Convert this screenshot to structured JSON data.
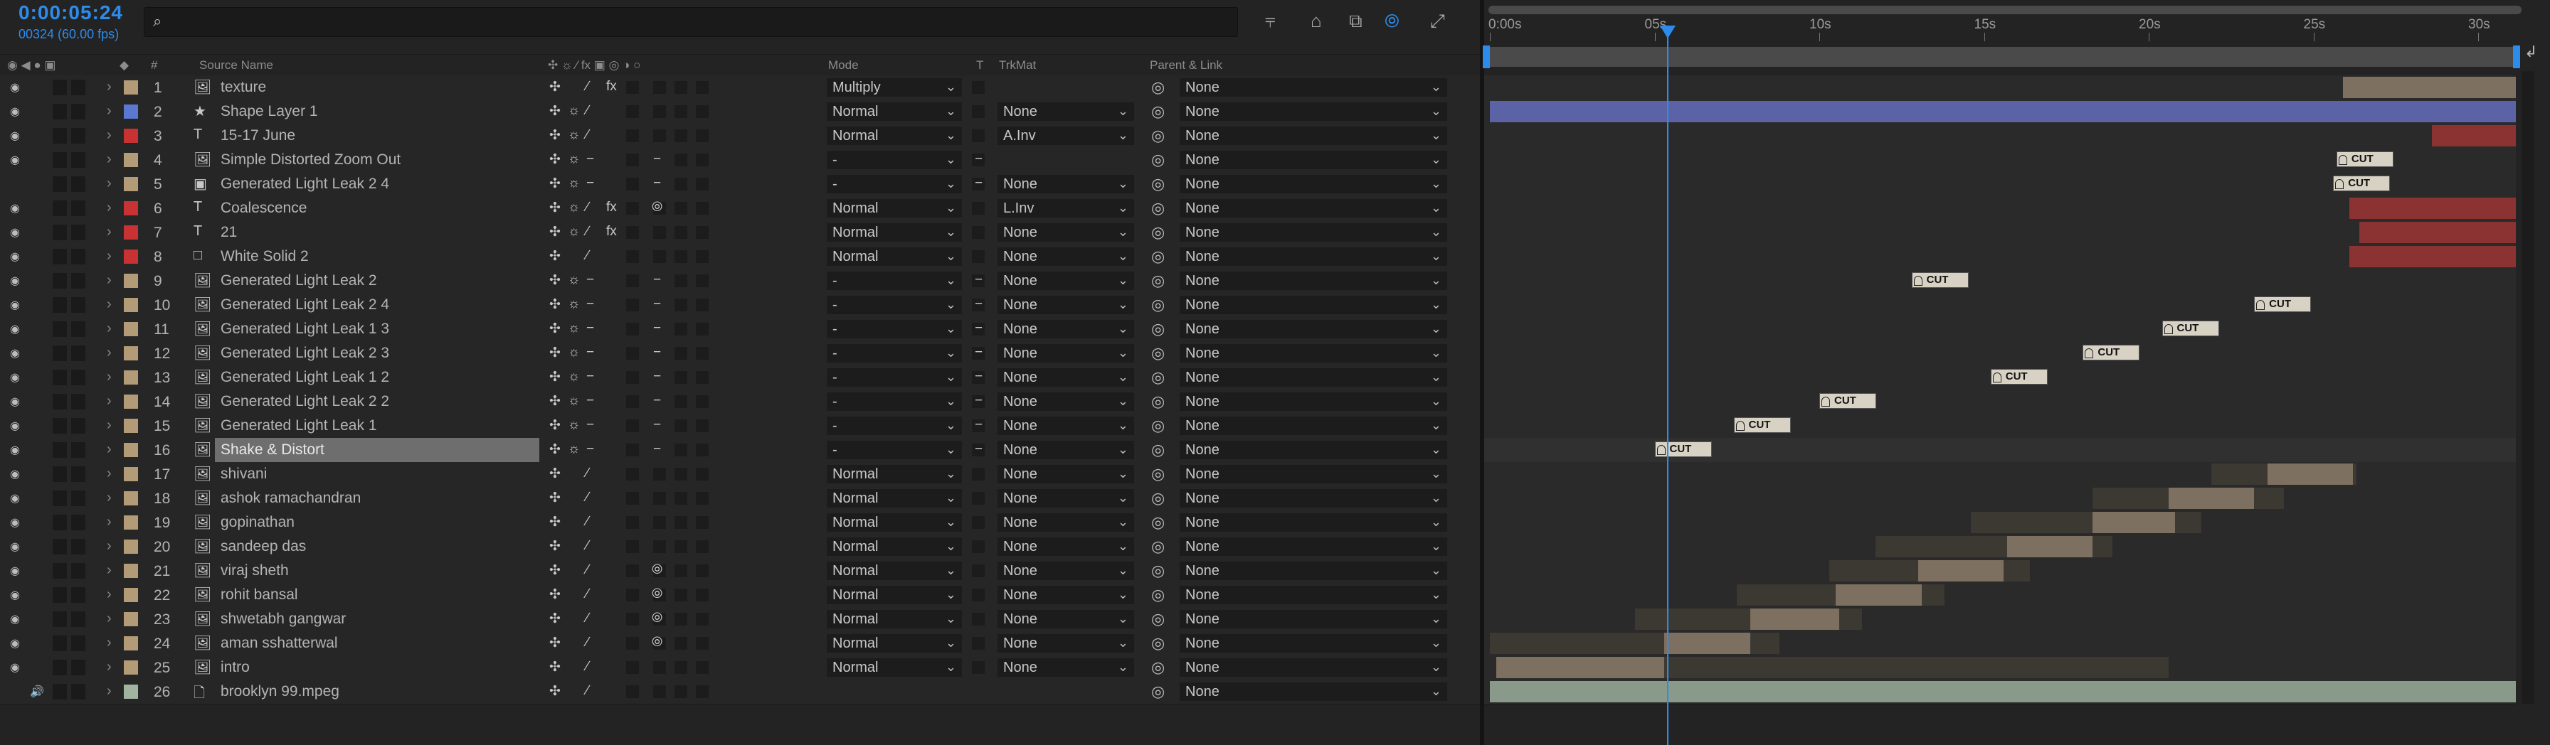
{
  "header": {
    "timecode": "0:00:05:24",
    "frame_info": "00324 (60.00 fps)",
    "search_placeholder": ""
  },
  "columns": {
    "hash": "#",
    "source_name": "Source Name",
    "mode": "Mode",
    "t": "T",
    "trkmat": "TrkMat",
    "parent_link": "Parent & Link"
  },
  "ruler": {
    "labels": [
      "0:00s",
      "05s",
      "10s",
      "15s",
      "20s",
      "25s",
      "30s"
    ],
    "current_time_s": 5.4
  },
  "colors": {
    "accent": "#2d8ceb",
    "label_tan": "#b49b78",
    "label_red": "#c83232",
    "label_blue": "#5a78d2",
    "label_white": "#f0f0f0",
    "label_sage": "#a0b4a0"
  },
  "layers": [
    {
      "num": "1",
      "name": "texture",
      "icon": "footage",
      "label": "#b49b78",
      "mode": "Multiply",
      "trkmat": "",
      "parent": "None",
      "eye": true,
      "switches": [
        "shy",
        "",
        "pencil",
        "fx"
      ],
      "bar": {
        "type": "solid",
        "start": 25.9,
        "end": 31.5,
        "color": "#7e7060"
      }
    },
    {
      "num": "2",
      "name": "Shape Layer 1",
      "icon": "shape",
      "label": "#5a78d2",
      "mode": "Normal",
      "trkmat": "None",
      "parent": "None",
      "eye": true,
      "switches": [
        "shy",
        "sun",
        "pencil",
        ""
      ],
      "bar": {
        "type": "solid",
        "start": 0,
        "end": 31.5,
        "color": "#5b63a6"
      }
    },
    {
      "num": "3",
      "name": "15-17 June",
      "icon": "text",
      "label": "#c83232",
      "mode": "Normal",
      "trkmat": "A.Inv",
      "parent": "None",
      "eye": true,
      "switches": [
        "shy",
        "sun",
        "pencil",
        ""
      ],
      "bar": {
        "type": "solid",
        "start": 28.6,
        "end": 31.5,
        "color": "#8b3232"
      }
    },
    {
      "num": "4",
      "name": "Simple Distorted Zoom Out",
      "icon": "footage",
      "label": "#b49b78",
      "mode": "-",
      "trkmat": "",
      "parent": "None",
      "eye": true,
      "switches": [
        "shy",
        "sun",
        "dash",
        ""
      ],
      "adj": true,
      "bar": {
        "type": "cut",
        "start": 25.7
      }
    },
    {
      "num": "5",
      "name": "Generated Light Leak 2 4",
      "icon": "comp",
      "label": "#b49b78",
      "mode": "-",
      "trkmat": "None",
      "parent": "None",
      "eye": false,
      "switches": [
        "shy",
        "sun",
        "dash",
        ""
      ],
      "adj": true,
      "bar": {
        "type": "cut",
        "start": 25.6
      }
    },
    {
      "num": "6",
      "name": "Coalescence",
      "icon": "text",
      "label": "#c83232",
      "mode": "Normal",
      "trkmat": "L.Inv",
      "parent": "None",
      "eye": true,
      "switches": [
        "shy",
        "sun",
        "pencil",
        "fx"
      ],
      "motion": true,
      "bar": {
        "type": "solid",
        "start": 26.1,
        "end": 31.5,
        "color": "#8b3232"
      }
    },
    {
      "num": "7",
      "name": "21",
      "icon": "text",
      "label": "#c83232",
      "mode": "Normal",
      "trkmat": "None",
      "parent": "None",
      "eye": true,
      "switches": [
        "shy",
        "sun",
        "pencil",
        "fx"
      ],
      "bar": {
        "type": "solid",
        "start": 26.4,
        "end": 31.5,
        "color": "#8b3232"
      }
    },
    {
      "num": "8",
      "name": "White Solid 2",
      "icon": "solid",
      "label": "#c83232",
      "mode": "Normal",
      "trkmat": "None",
      "parent": "None",
      "eye": true,
      "switches": [
        "shy",
        "",
        "pencil",
        ""
      ],
      "bar": {
        "type": "solid",
        "start": 26.1,
        "end": 31.5,
        "color": "#8b3232"
      }
    },
    {
      "num": "9",
      "name": "Generated Light Leak 2",
      "icon": "footage",
      "label": "#b49b78",
      "mode": "-",
      "trkmat": "None",
      "parent": "None",
      "eye": true,
      "switches": [
        "shy",
        "sun",
        "dash",
        ""
      ],
      "adj": true,
      "bar": {
        "type": "cut",
        "start": 12.8
      }
    },
    {
      "num": "10",
      "name": "Generated Light Leak 2 4",
      "icon": "footage",
      "label": "#b49b78",
      "mode": "-",
      "trkmat": "None",
      "parent": "None",
      "eye": true,
      "switches": [
        "shy",
        "sun",
        "dash",
        ""
      ],
      "adj": true,
      "bar": {
        "type": "cut",
        "start": 23.2
      }
    },
    {
      "num": "11",
      "name": "Generated Light Leak 1 3",
      "icon": "footage",
      "label": "#b49b78",
      "mode": "-",
      "trkmat": "None",
      "parent": "None",
      "eye": true,
      "switches": [
        "shy",
        "sun",
        "dash",
        ""
      ],
      "adj": true,
      "bar": {
        "type": "cut",
        "start": 20.4
      }
    },
    {
      "num": "12",
      "name": "Generated Light Leak 2 3",
      "icon": "footage",
      "label": "#b49b78",
      "mode": "-",
      "trkmat": "None",
      "parent": "None",
      "eye": true,
      "switches": [
        "shy",
        "sun",
        "dash",
        ""
      ],
      "adj": true,
      "bar": {
        "type": "cut",
        "start": 18.0
      }
    },
    {
      "num": "13",
      "name": "Generated Light Leak 1 2",
      "icon": "footage",
      "label": "#b49b78",
      "mode": "-",
      "trkmat": "None",
      "parent": "None",
      "eye": true,
      "switches": [
        "shy",
        "sun",
        "dash",
        ""
      ],
      "adj": true,
      "bar": {
        "type": "cut",
        "start": 15.2
      }
    },
    {
      "num": "14",
      "name": "Generated Light Leak 2 2",
      "icon": "footage",
      "label": "#b49b78",
      "mode": "-",
      "trkmat": "None",
      "parent": "None",
      "eye": true,
      "switches": [
        "shy",
        "sun",
        "dash",
        ""
      ],
      "adj": true,
      "bar": {
        "type": "cut",
        "start": 10.0
      }
    },
    {
      "num": "15",
      "name": "Generated Light Leak 1",
      "icon": "footage",
      "label": "#b49b78",
      "mode": "-",
      "trkmat": "None",
      "parent": "None",
      "eye": true,
      "switches": [
        "shy",
        "sun",
        "dash",
        ""
      ],
      "adj": true,
      "bar": {
        "type": "cut",
        "start": 7.4
      }
    },
    {
      "num": "16",
      "name": "Shake & Distort",
      "icon": "footage",
      "label": "#b49b78",
      "mode": "-",
      "trkmat": "None",
      "parent": "None",
      "eye": true,
      "selected": true,
      "switches": [
        "shy",
        "sun",
        "dash",
        ""
      ],
      "adj": true,
      "bar": {
        "type": "cut",
        "start": 5.0
      }
    },
    {
      "num": "17",
      "name": "shivani",
      "icon": "footage",
      "label": "#b49b78",
      "mode": "Normal",
      "trkmat": "None",
      "parent": "None",
      "eye": true,
      "switches": [
        "shy",
        "",
        "pencil",
        ""
      ],
      "bar": {
        "type": "clip",
        "start": 21.9,
        "in": 23.6,
        "out": 26.2,
        "end": 26.3
      }
    },
    {
      "num": "18",
      "name": "ashok ramachandran",
      "icon": "footage",
      "label": "#b49b78",
      "mode": "Normal",
      "trkmat": "None",
      "parent": "None",
      "eye": true,
      "switches": [
        "shy",
        "",
        "pencil",
        ""
      ],
      "bar": {
        "type": "clip",
        "start": 18.3,
        "in": 20.6,
        "out": 23.2,
        "end": 24.1
      }
    },
    {
      "num": "19",
      "name": "gopinathan",
      "icon": "footage",
      "label": "#b49b78",
      "mode": "Normal",
      "trkmat": "None",
      "parent": "None",
      "eye": true,
      "switches": [
        "shy",
        "",
        "pencil",
        ""
      ],
      "bar": {
        "type": "clip",
        "start": 14.6,
        "in": 18.3,
        "out": 20.8,
        "end": 21.6
      }
    },
    {
      "num": "20",
      "name": "sandeep das",
      "icon": "footage",
      "label": "#b49b78",
      "mode": "Normal",
      "trkmat": "None",
      "parent": "None",
      "eye": true,
      "switches": [
        "shy",
        "",
        "pencil",
        ""
      ],
      "bar": {
        "type": "clip",
        "start": 11.7,
        "in": 15.7,
        "out": 18.3,
        "end": 18.9
      }
    },
    {
      "num": "21",
      "name": "viraj sheth",
      "icon": "footage",
      "label": "#b49b78",
      "mode": "Normal",
      "trkmat": "None",
      "parent": "None",
      "eye": true,
      "switches": [
        "shy",
        "",
        "pencil",
        ""
      ],
      "motion": true,
      "bar": {
        "type": "clip",
        "start": 10.3,
        "in": 13.0,
        "out": 15.6,
        "end": 16.4
      }
    },
    {
      "num": "22",
      "name": "rohit bansal",
      "icon": "footage",
      "label": "#b49b78",
      "mode": "Normal",
      "trkmat": "None",
      "parent": "None",
      "eye": true,
      "switches": [
        "shy",
        "",
        "pencil",
        ""
      ],
      "motion": true,
      "bar": {
        "type": "clip",
        "start": 7.5,
        "in": 10.5,
        "out": 13.1,
        "end": 13.8
      }
    },
    {
      "num": "23",
      "name": "shwetabh gangwar",
      "icon": "footage",
      "label": "#b49b78",
      "mode": "Normal",
      "trkmat": "None",
      "parent": "None",
      "eye": true,
      "switches": [
        "shy",
        "",
        "pencil",
        ""
      ],
      "motion": true,
      "bar": {
        "type": "clip",
        "start": 4.4,
        "in": 7.9,
        "out": 10.6,
        "end": 11.3
      }
    },
    {
      "num": "24",
      "name": "aman sshatterwal",
      "icon": "footage",
      "label": "#b49b78",
      "mode": "Normal",
      "trkmat": "None",
      "parent": "None",
      "eye": true,
      "switches": [
        "shy",
        "",
        "pencil",
        ""
      ],
      "motion": true,
      "bar": {
        "type": "clip",
        "start": 0,
        "in": 5.3,
        "out": 7.9,
        "end": 8.8
      }
    },
    {
      "num": "25",
      "name": "intro",
      "icon": "footage",
      "label": "#b49b78",
      "mode": "Normal",
      "trkmat": "None",
      "parent": "None",
      "eye": true,
      "switches": [
        "shy",
        "",
        "pencil",
        ""
      ],
      "bar": {
        "type": "clip",
        "start": 0.2,
        "in": 0.2,
        "out": 5.3,
        "end": 20.6
      }
    },
    {
      "num": "26",
      "name": "brooklyn 99.mpeg",
      "icon": "audio-file",
      "label": "#a0b4a0",
      "mode": "",
      "trkmat": "",
      "parent": "None",
      "eye": false,
      "audio": true,
      "switches": [
        "shy",
        "",
        "pencil",
        ""
      ],
      "bar": {
        "type": "solid",
        "start": 0,
        "end": 31.5,
        "color": "#8a9a8a"
      }
    }
  ]
}
